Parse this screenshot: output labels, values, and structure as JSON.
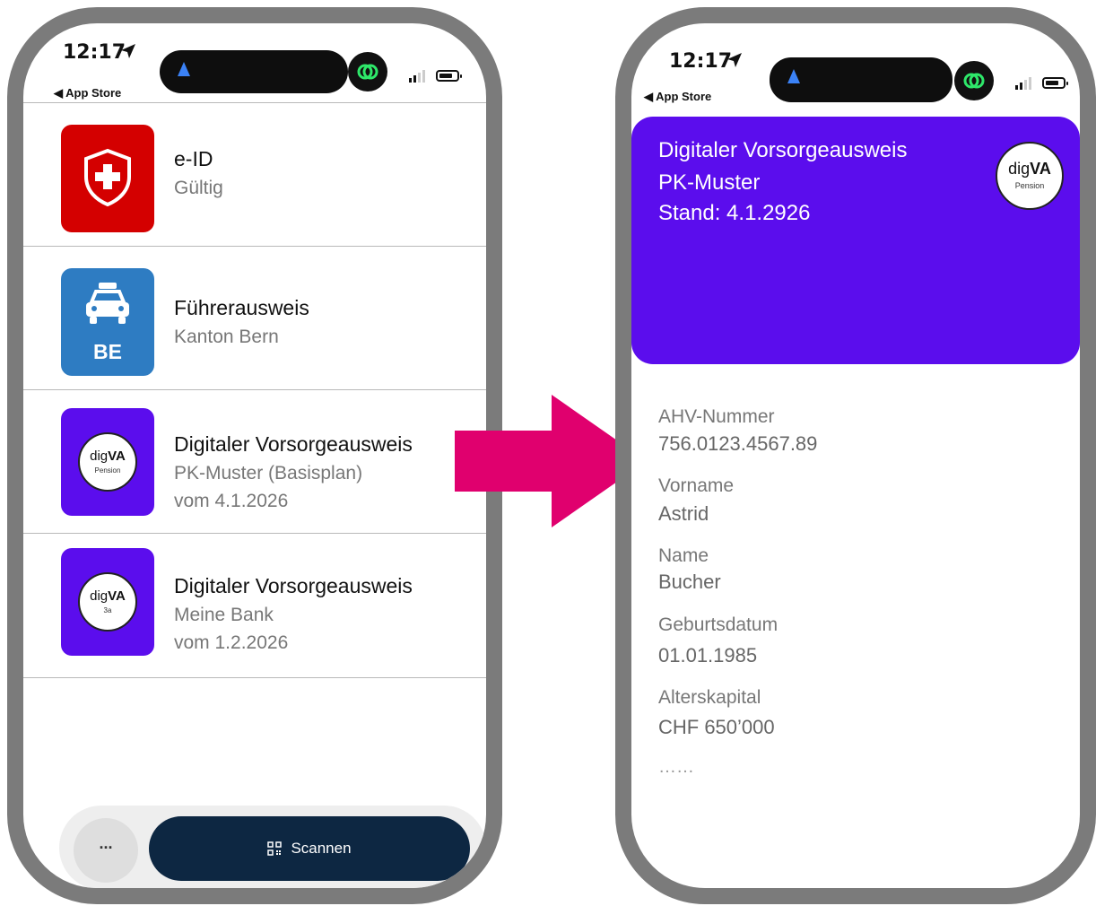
{
  "status_bar": {
    "time": "12:17",
    "back_label": "◀ App Store"
  },
  "left": {
    "items": [
      {
        "title": "e-ID",
        "lines": [
          "Gültig"
        ]
      },
      {
        "title": "Führerausweis",
        "lines": [
          "Kanton Bern"
        ],
        "icon_text": "BE"
      },
      {
        "title": "Digitaler Vorsorgeausweis",
        "lines": [
          "PK-Muster (Basisplan)",
          "vom 4.1.2026"
        ],
        "badge_main": "dig",
        "badge_bold": "VA",
        "badge_sub": "Pension"
      },
      {
        "title": "Digitaler Vorsorgeausweis",
        "lines": [
          "Meine Bank",
          "vom 1.2.2026"
        ],
        "badge_main": "dig",
        "badge_bold": "VA",
        "badge_sub": "3a"
      }
    ],
    "more_label": "...",
    "scan_label": "Scannen"
  },
  "right": {
    "card": {
      "line1": "Digitaler Vorsorgeausweis",
      "line2": "PK-Muster",
      "line3": "Stand: 4.1.2926",
      "badge_main": "dig",
      "badge_bold": "VA",
      "badge_sub": "Pension"
    },
    "fields": [
      {
        "label": "AHV-Nummer",
        "value": "756.0123.4567.89"
      },
      {
        "label": "Vorname",
        "value": "Astrid"
      },
      {
        "label": "Name",
        "value": "Bucher"
      },
      {
        "label": "Geburtsdatum",
        "value": "01.01.1985"
      },
      {
        "label": "Alterskapital",
        "value": "CHF 650’000"
      }
    ],
    "ellipsis": "……"
  },
  "colors": {
    "card_purple": "#5b0ded",
    "arrow_magenta": "#e0006e",
    "scan_button": "#0d2742",
    "eid_red": "#d40000",
    "license_blue": "#2e7cc2"
  }
}
